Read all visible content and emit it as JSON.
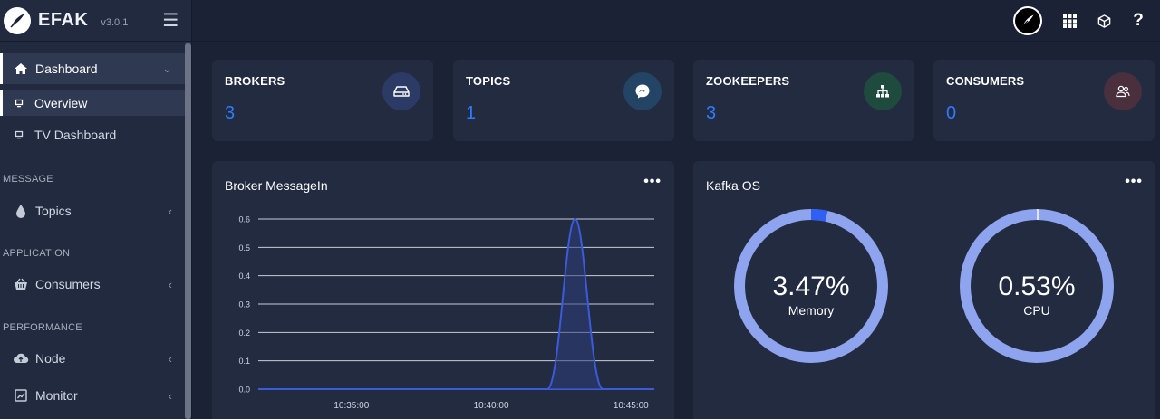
{
  "app": {
    "name": "EFAK",
    "version": "v3.0.1"
  },
  "sidebar": {
    "dashboard": "Dashboard",
    "overview": "Overview",
    "tv_dashboard": "TV Dashboard",
    "sections": {
      "message": "MESSAGE",
      "application": "APPLICATION",
      "performance": "PERFORMANCE"
    },
    "items": {
      "topics": "Topics",
      "consumers": "Consumers",
      "node": "Node",
      "monitor": "Monitor"
    }
  },
  "topbar": {
    "help": "?"
  },
  "stats": [
    {
      "label": "BROKERS",
      "value": "3",
      "icon": "hard-drive-icon"
    },
    {
      "label": "TOPICS",
      "value": "1",
      "icon": "messenger-icon"
    },
    {
      "label": "ZOOKEEPERS",
      "value": "3",
      "icon": "sitemap-icon"
    },
    {
      "label": "CONSUMERS",
      "value": "0",
      "icon": "users-icon"
    }
  ],
  "broker_panel": {
    "title": "Broker MessageIn",
    "more": "•••"
  },
  "os_panel": {
    "title": "Kafka OS",
    "more": "•••",
    "memory": {
      "value": "3.47%",
      "label": "Memory",
      "percent": 3.47
    },
    "cpu": {
      "value": "0.53%",
      "label": "CPU",
      "percent": 0.53
    }
  },
  "colors": {
    "accent": "#2f7bff",
    "line": "#3b5bdb",
    "ring": "#8fa4ee"
  },
  "chart_data": {
    "type": "area",
    "title": "Broker MessageIn",
    "xlabel": "",
    "ylabel": "",
    "y_ticks": [
      "0.0",
      "0.1",
      "0.2",
      "0.3",
      "0.4",
      "0.5",
      "0.6"
    ],
    "x_ticks": [
      "10:35:00",
      "10:40:00",
      "10:45:00"
    ],
    "ylim": [
      0,
      0.6
    ],
    "xlim": [
      "10:31:40",
      "10:45:50"
    ],
    "x": [
      "10:31:40",
      "10:42:00",
      "10:42:40",
      "10:43:00",
      "10:43:20",
      "10:44:00",
      "10:45:50"
    ],
    "values": [
      0,
      0,
      0.3,
      0.6,
      0.3,
      0,
      0
    ]
  }
}
